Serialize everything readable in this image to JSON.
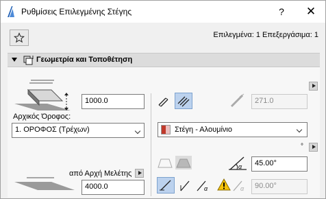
{
  "window": {
    "title": "Ρυθμίσεις Επιλεγμένης Στέγης",
    "help_label": "?",
    "close_label": "✕"
  },
  "header": {
    "selected_info": "Επιλεγμένα: 1 Επεξεργάσιμα: 1"
  },
  "section": {
    "title": "Γεωμετρία και Τοποθέτηση"
  },
  "left": {
    "home_story_offset": "1000.0",
    "home_story_label": "Αρχικός Όροφος:",
    "home_story_value": "1. ΟΡΟΦΟΣ (Τρέχων)",
    "project_zero_label": "από Αρχή Μελέτης",
    "project_zero_value": "4000.0"
  },
  "right": {
    "thickness_value": "271.0",
    "material_value": "Στέγη - Αλουμίνιο",
    "degree_unit": "°",
    "pitch_value": "45.00°",
    "angle_value": "90.00°"
  },
  "colors": {
    "active_bg": "#bcd2ee",
    "warning": "#f4c20d",
    "material_red": "#c0392b"
  }
}
